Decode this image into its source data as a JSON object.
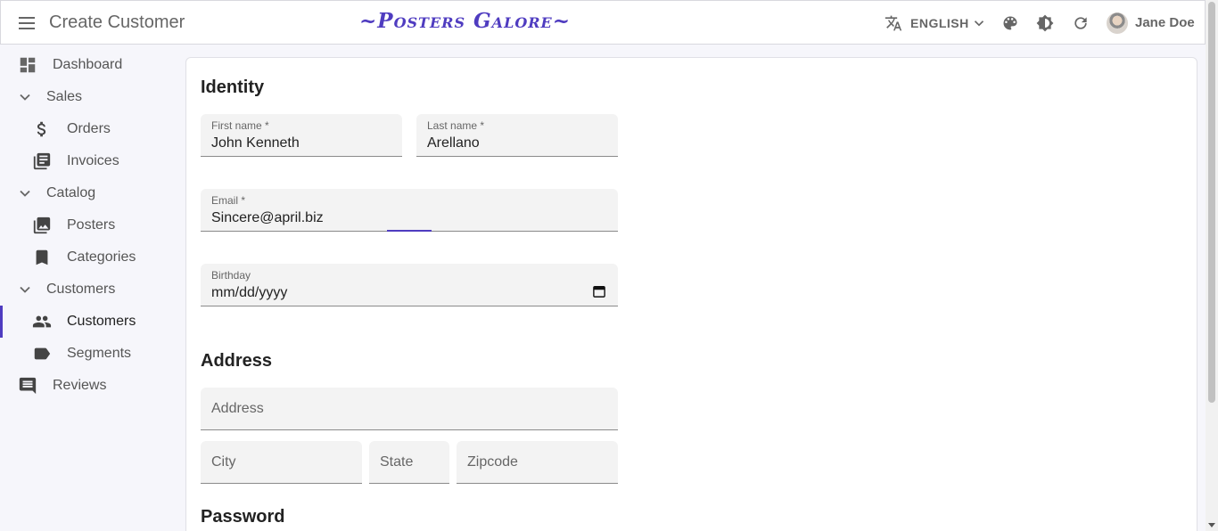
{
  "appbar": {
    "title": "Create Customer",
    "brand": "~Posters Galore~",
    "language": "ENGLISH",
    "user_name": "Jane Doe"
  },
  "sidebar": {
    "items": [
      {
        "label": "Dashboard",
        "icon": "dashboard-icon"
      },
      {
        "label": "Sales",
        "icon": "chevron-down-icon"
      },
      {
        "label": "Orders",
        "icon": "dollar-icon"
      },
      {
        "label": "Invoices",
        "icon": "library-books-icon"
      },
      {
        "label": "Catalog",
        "icon": "chevron-down-icon"
      },
      {
        "label": "Posters",
        "icon": "collections-icon"
      },
      {
        "label": "Categories",
        "icon": "bookmark-icon"
      },
      {
        "label": "Customers",
        "icon": "chevron-down-icon"
      },
      {
        "label": "Customers",
        "icon": "people-icon"
      },
      {
        "label": "Segments",
        "icon": "label-icon"
      },
      {
        "label": "Reviews",
        "icon": "comment-icon"
      }
    ]
  },
  "form": {
    "identity_title": "Identity",
    "first_name": {
      "label": "First name *",
      "value": "John Kenneth"
    },
    "last_name": {
      "label": "Last name *",
      "value": "Arellano"
    },
    "email": {
      "label": "Email *",
      "value": "Sincere@april.biz"
    },
    "birthday": {
      "label": "Birthday",
      "value": "mm/dd/yyyy"
    },
    "address_title": "Address",
    "address": {
      "placeholder": "Address"
    },
    "city": {
      "placeholder": "City"
    },
    "state": {
      "placeholder": "State"
    },
    "zipcode": {
      "placeholder": "Zipcode"
    },
    "password_title": "Password"
  },
  "colors": {
    "accent": "#4f3cc0",
    "background": "#f6f6fb"
  }
}
